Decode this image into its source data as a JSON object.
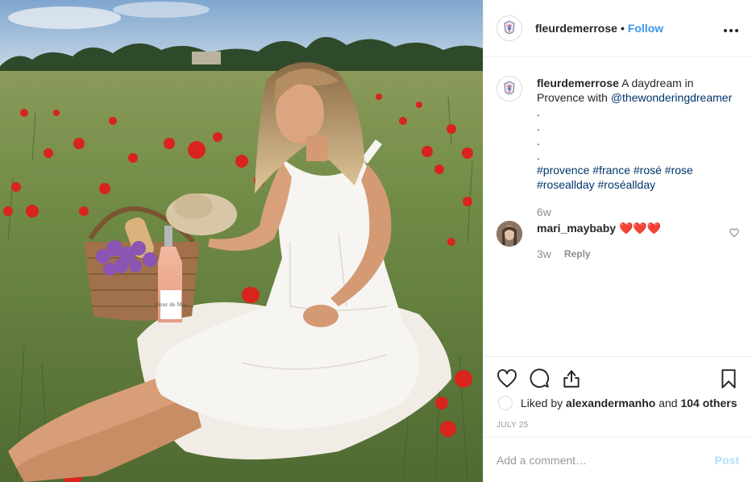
{
  "photo": {
    "alt": "Woman in white dress sitting in a poppy field with a picnic basket and rosé",
    "bottle_label": "Fleur de Mer"
  },
  "header": {
    "username": "fleurdemerrose",
    "separator": "•",
    "follow_label": "Follow",
    "more_icon": "ellipsis-icon"
  },
  "caption": {
    "username": "fleurdemerrose",
    "text_before_mention": "A daydream in Provence with ",
    "mention": "@thewonderingdreamer",
    "dots": [
      ".",
      ".",
      ".",
      "."
    ],
    "hashtags": [
      "#provence",
      "#france",
      "#rosé",
      "#rose",
      "#roseallday",
      "#roséallday"
    ],
    "time": "6w"
  },
  "comment": {
    "username": "mari_maybaby",
    "text": "❤️❤️❤️",
    "time": "3w",
    "reply_label": "Reply"
  },
  "actions": {
    "like_icon": "heart-icon",
    "comment_icon": "comment-icon",
    "share_icon": "share-icon",
    "save_icon": "bookmark-icon"
  },
  "likes": {
    "prefix": "Liked by ",
    "user": "alexandermanho",
    "middle": " and ",
    "others": "104 others"
  },
  "date": "JULY 25",
  "add_comment": {
    "placeholder": "Add a comment…",
    "post_label": "Post"
  },
  "colors": {
    "link": "#003569",
    "follow": "#3897f0",
    "post_disabled": "#b2dffc",
    "heart": "#ed4956"
  }
}
